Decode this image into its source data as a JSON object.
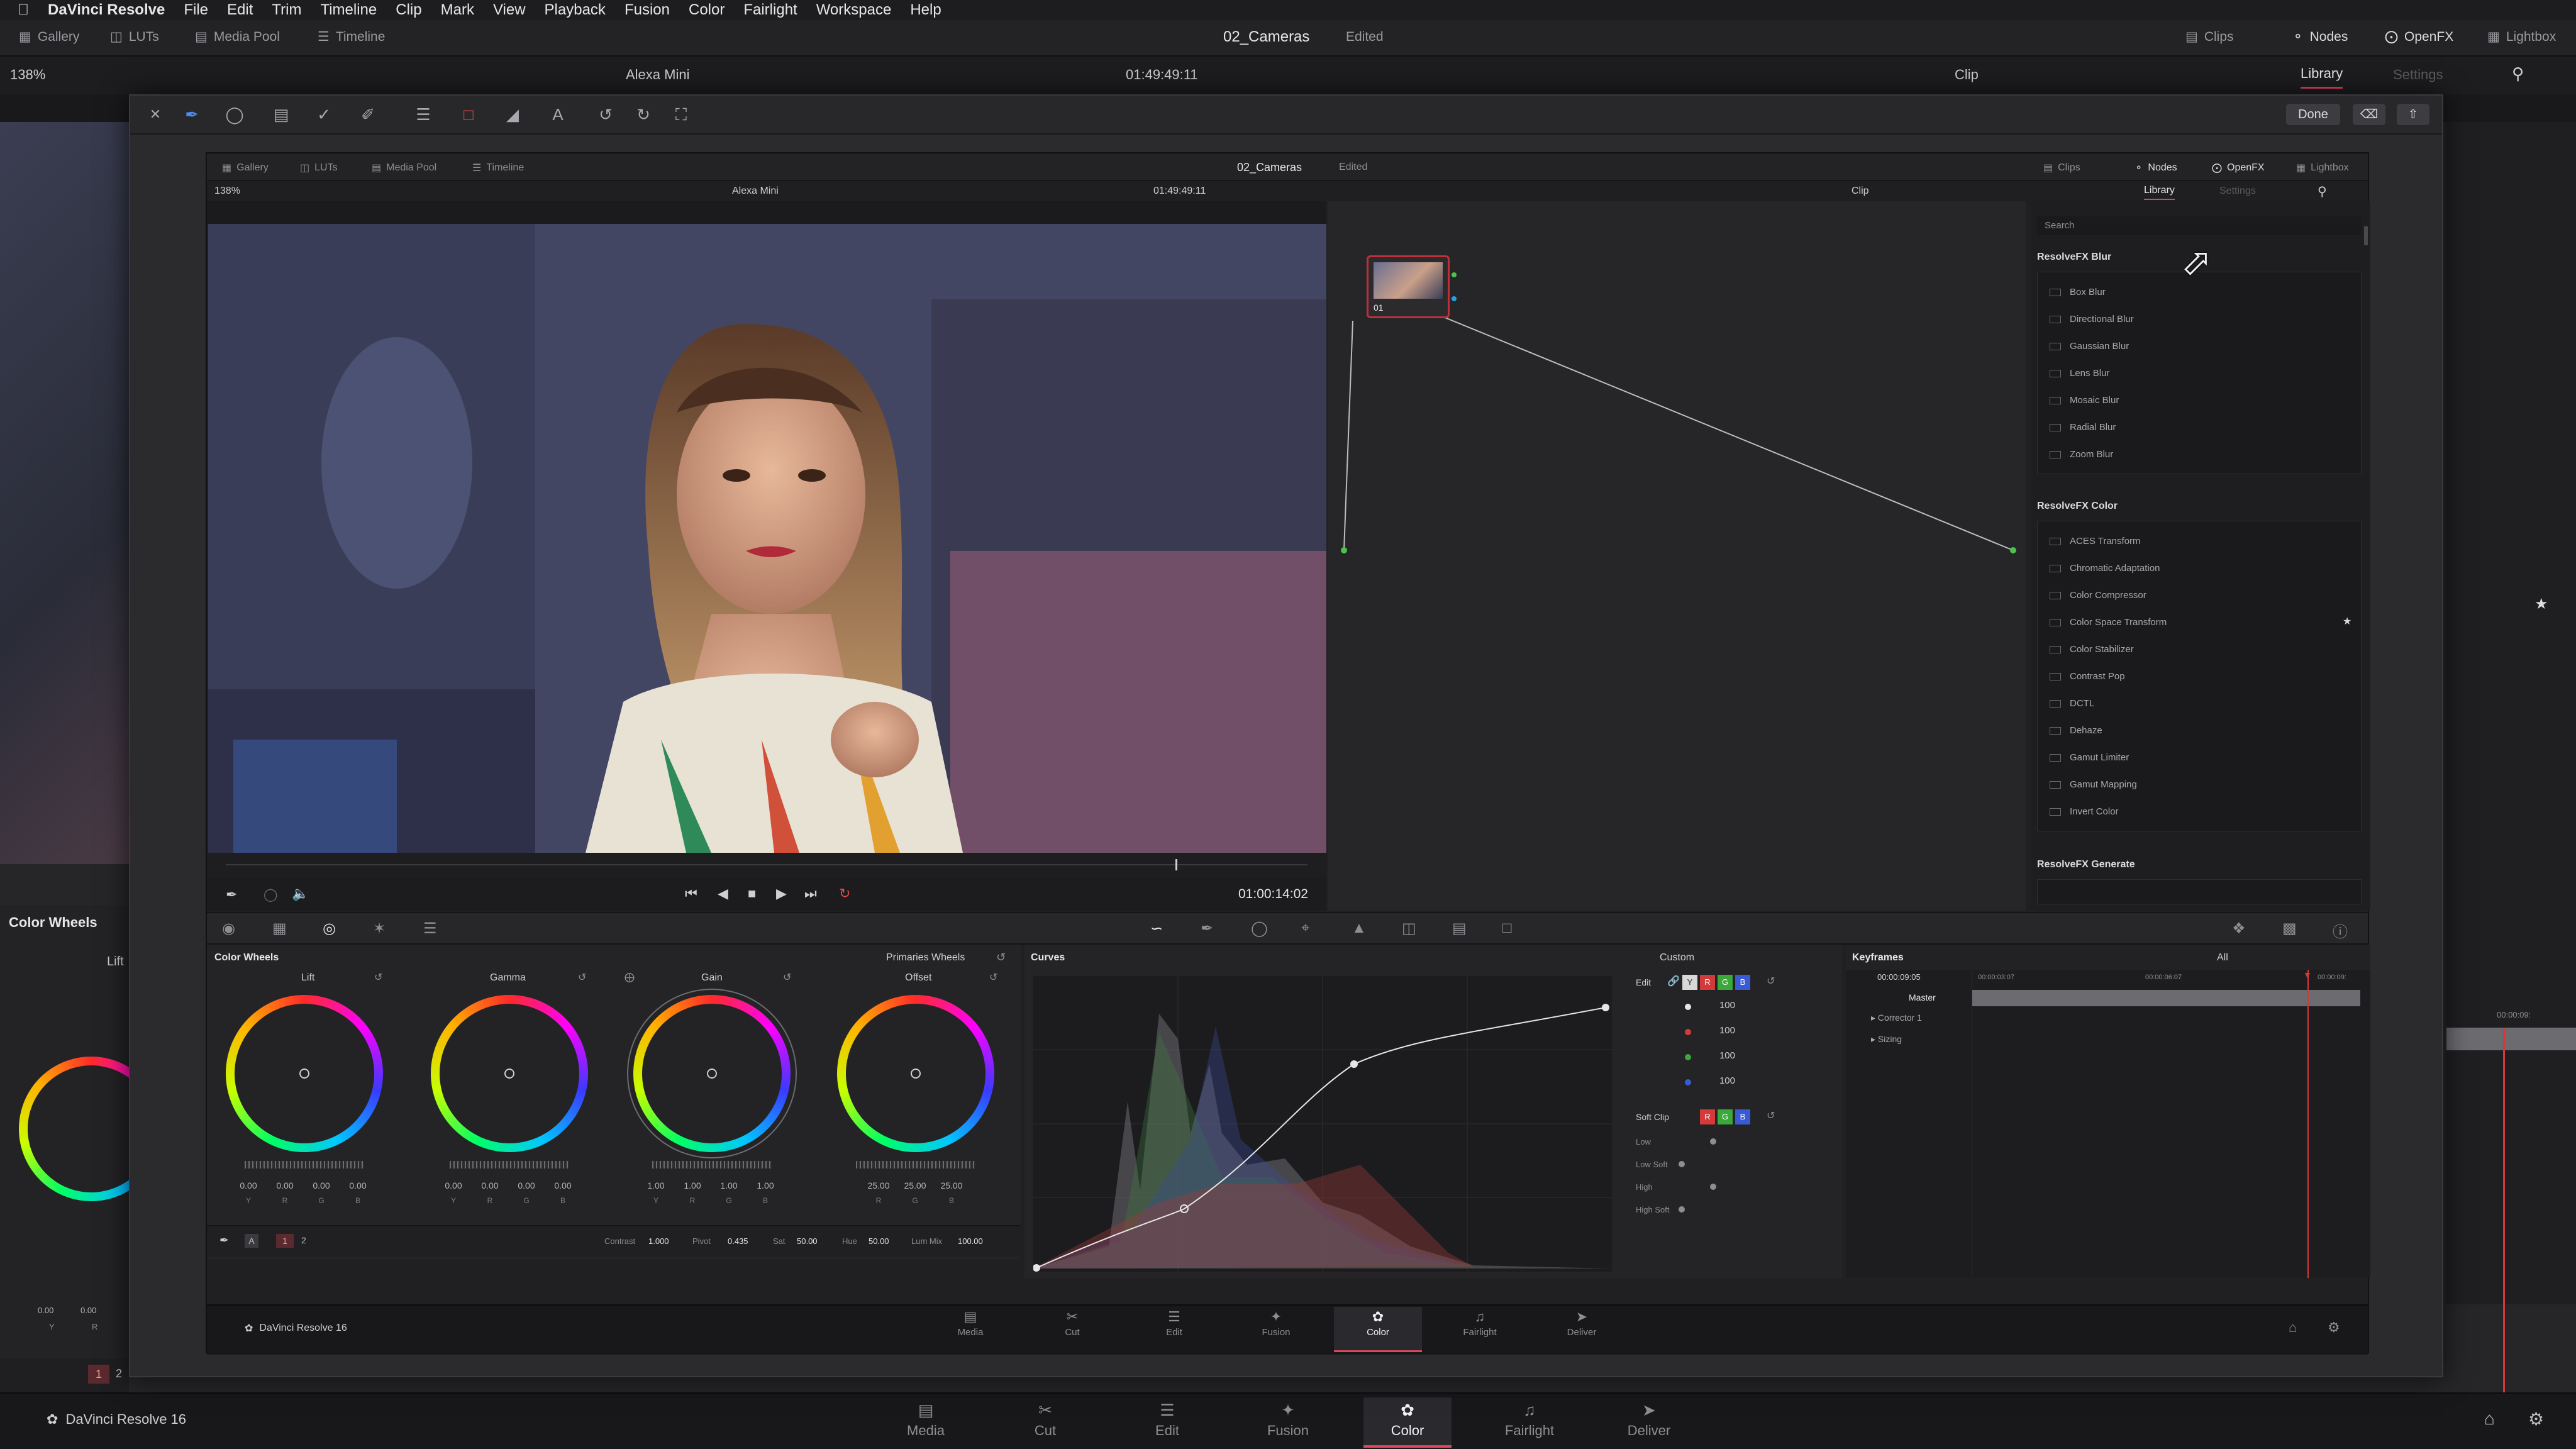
{
  "menubar": {
    "app_name": "DaVinci Resolve",
    "items": [
      "File",
      "Edit",
      "Trim",
      "Timeline",
      "Clip",
      "Mark",
      "View",
      "Playback",
      "Fusion",
      "Color",
      "Fairlight",
      "Workspace",
      "Help"
    ]
  },
  "outer": {
    "toolbar": {
      "gallery": "Gallery",
      "luts": "LUTs",
      "media_pool": "Media Pool",
      "timeline": "Timeline",
      "project": "02_Cameras",
      "edited": "Edited",
      "clips": "Clips",
      "nodes": "Nodes",
      "openfx": "OpenFX",
      "lightbox": "Lightbox"
    },
    "viewer_bar": {
      "zoom": "138%",
      "camera": "Alexa Mini",
      "timecode": "01:49:49:11",
      "clip": "Clip",
      "library_tab": "Library",
      "settings_tab": "Settings"
    },
    "left_panel_title": "Color Wheels",
    "left_wheel_label": "Lift",
    "left_values": [
      "0.00",
      "0.00"
    ],
    "left_letters": [
      "Y",
      "R"
    ],
    "left_node_nums": [
      "1",
      "2"
    ],
    "keyframe_tc": "00:00:09:",
    "brand": "DaVinci Resolve 16",
    "pages": [
      "Media",
      "Cut",
      "Edit",
      "Fusion",
      "Color",
      "Fairlight",
      "Deliver"
    ],
    "active_page": "Color"
  },
  "overlay": {
    "done_label": "Done"
  },
  "inner": {
    "toolbar": {
      "gallery": "Gallery",
      "luts": "LUTs",
      "media_pool": "Media Pool",
      "timeline": "Timeline",
      "project": "02_Cameras",
      "edited": "Edited",
      "clips": "Clips",
      "nodes": "Nodes",
      "openfx": "OpenFX",
      "lightbox": "Lightbox"
    },
    "viewer_bar": {
      "zoom": "138%",
      "camera": "Alexa Mini",
      "timecode": "01:49:49:11",
      "clip": "Clip",
      "library_tab": "Library",
      "settings_tab": "Settings"
    },
    "transport_timecode": "01:00:14:02",
    "node": {
      "label": "01"
    },
    "library": {
      "search_placeholder": "Search",
      "sections": [
        {
          "title": "ResolveFX Blur",
          "items": [
            "Box Blur",
            "Directional Blur",
            "Gaussian Blur",
            "Lens Blur",
            "Mosaic Blur",
            "Radial Blur",
            "Zoom Blur"
          ]
        },
        {
          "title": "ResolveFX Color",
          "items": [
            "ACES Transform",
            "Chromatic Adaptation",
            "Color Compressor",
            "Color Space Transform",
            "Color Stabilizer",
            "Contrast Pop",
            "DCTL",
            "Dehaze",
            "Gamut Limiter",
            "Gamut Mapping",
            "Invert Color"
          ]
        },
        {
          "title": "ResolveFX Generate",
          "items": []
        }
      ]
    },
    "color_wheels": {
      "title": "Color Wheels",
      "mode": "Primaries Wheels",
      "wheels": [
        {
          "name": "Lift",
          "values": [
            "0.00",
            "0.00",
            "0.00",
            "0.00"
          ]
        },
        {
          "name": "Gamma",
          "values": [
            "0.00",
            "0.00",
            "0.00",
            "0.00"
          ]
        },
        {
          "name": "Gain",
          "values": [
            "1.00",
            "1.00",
            "1.00",
            "1.00"
          ]
        },
        {
          "name": "Offset",
          "values": [
            "25.00",
            "25.00",
            "25.00"
          ]
        }
      ],
      "letters4": [
        "Y",
        "R",
        "G",
        "B"
      ],
      "letters3": [
        "R",
        "G",
        "B"
      ],
      "node_nums": [
        "1",
        "2"
      ],
      "params": {
        "contrast_label": "Contrast",
        "contrast": "1.000",
        "pivot_label": "Pivot",
        "pivot": "0.435",
        "sat_label": "Sat",
        "sat": "50.00",
        "hue_label": "Hue",
        "hue": "50.00",
        "lummix_label": "Lum Mix",
        "lummix": "100.00"
      }
    },
    "curves": {
      "title": "Curves",
      "mode": "Custom",
      "edit_label": "Edit",
      "edit_values": [
        "100",
        "100",
        "100",
        "100"
      ],
      "channel_letters": [
        "Y",
        "R",
        "G",
        "B"
      ],
      "softclip_label": "Soft Clip",
      "softclip_items": [
        "Low",
        "Low Soft",
        "High",
        "High Soft"
      ]
    },
    "keyframes": {
      "title": "Keyframes",
      "filter": "All",
      "current_tc": "00:00:09:05",
      "ruler": [
        "00:00:03:07",
        "00:00:06:07",
        "00:00:09:"
      ],
      "rows": [
        "Master",
        "Corrector 1",
        "Sizing"
      ]
    },
    "brand": "DaVinci Resolve 16",
    "pages": [
      "Media",
      "Cut",
      "Edit",
      "Fusion",
      "Color",
      "Fairlight",
      "Deliver"
    ],
    "active_page": "Color"
  }
}
